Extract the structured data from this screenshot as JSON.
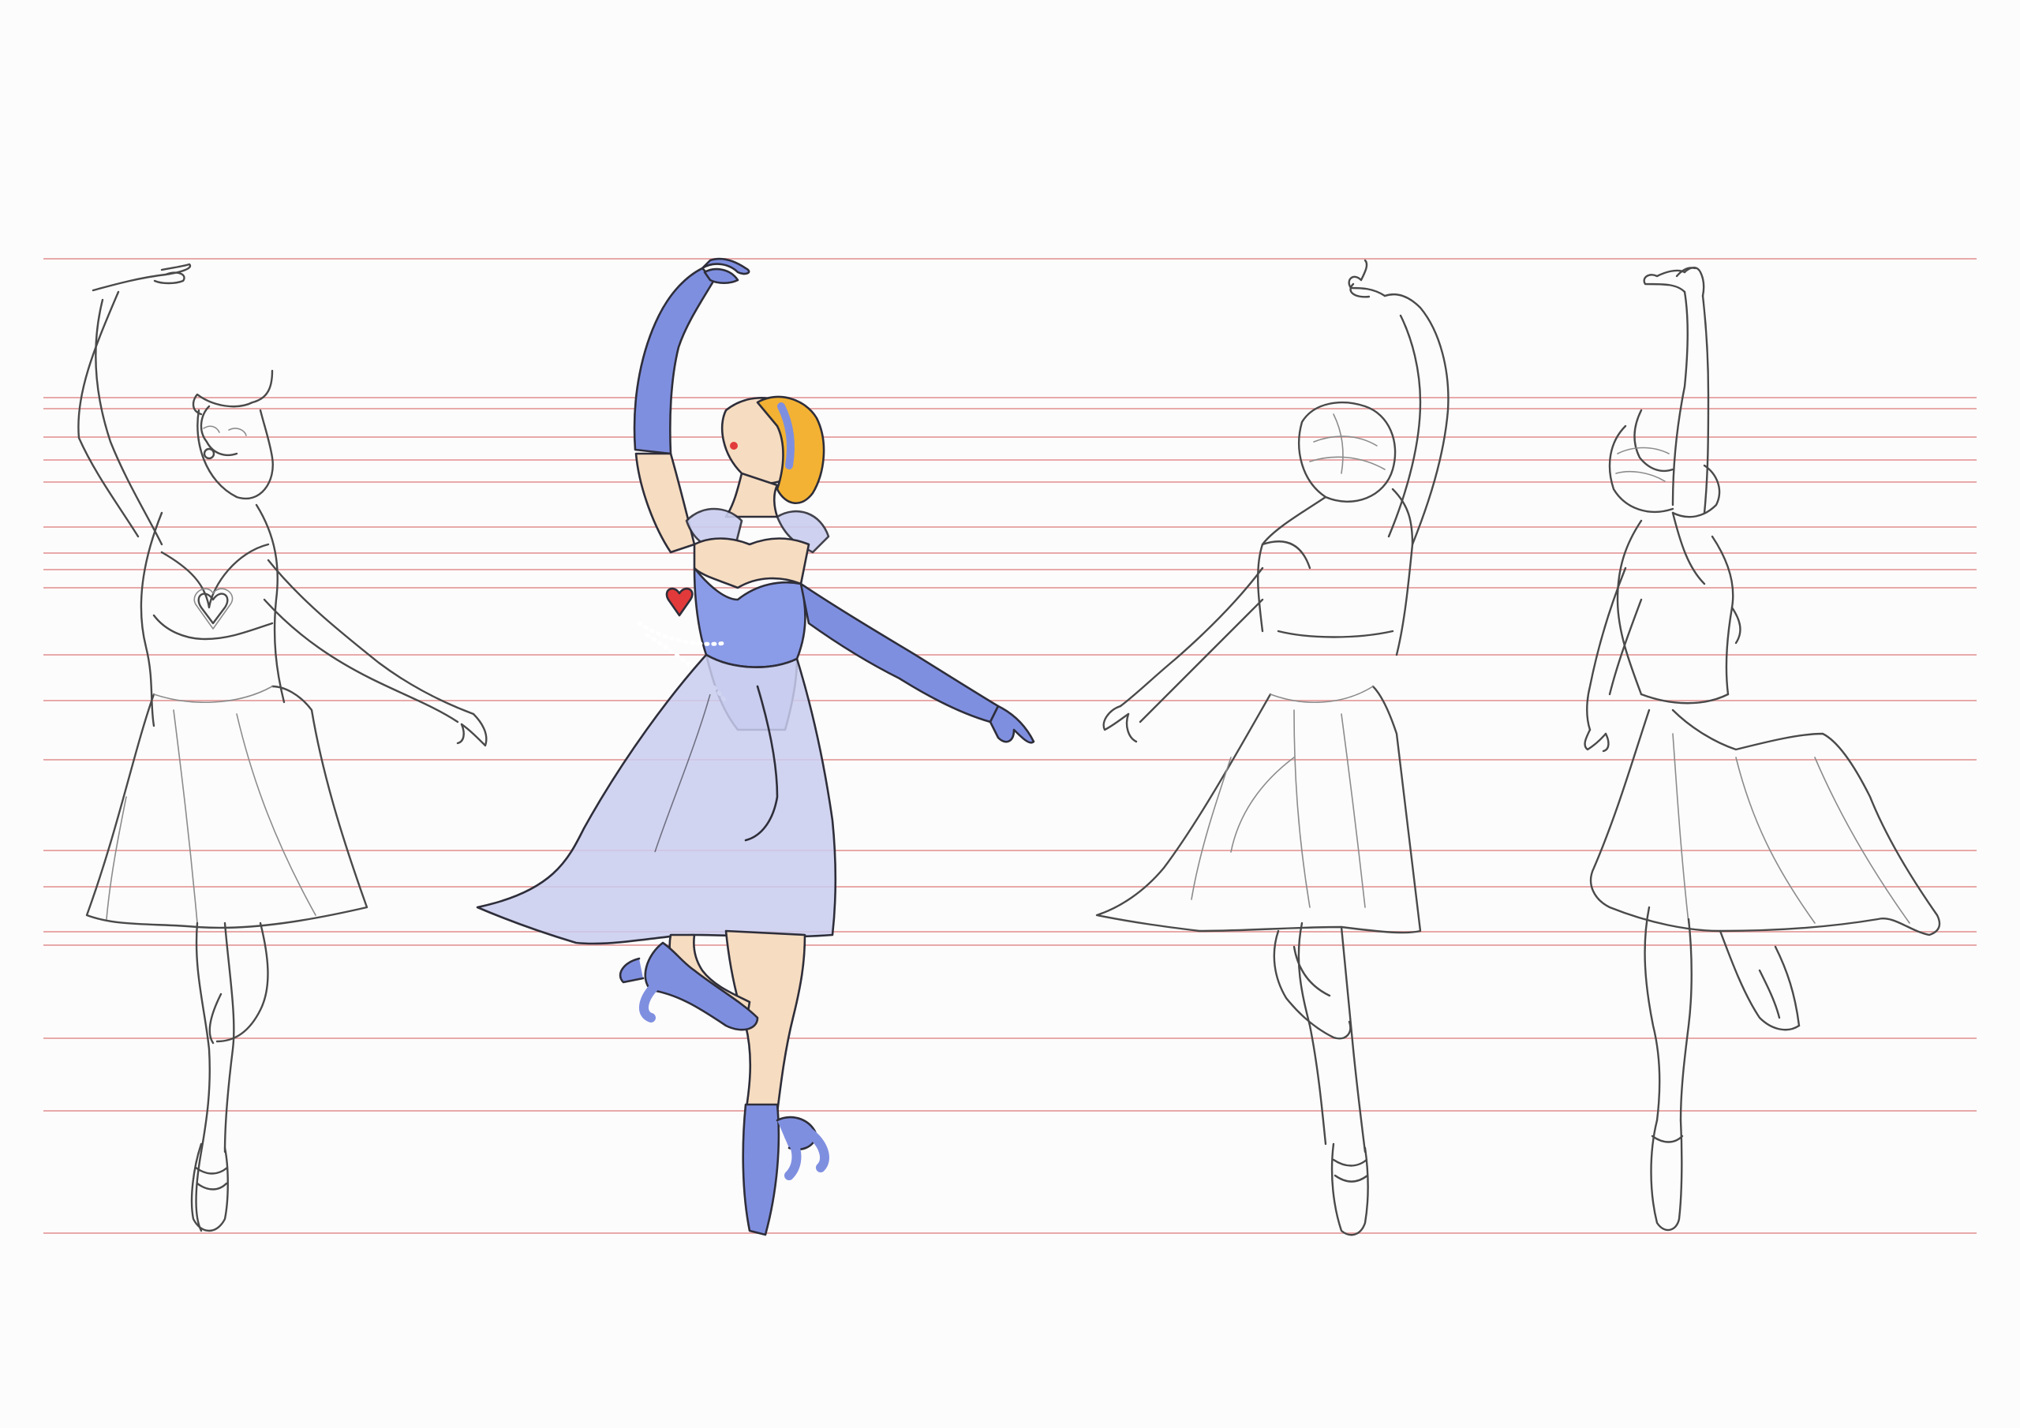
{
  "sheet": {
    "background": "#fdfcfc",
    "guide_color": "#e8a9a9",
    "sketch_color": "#4a4a4a",
    "palette": {
      "glove_and_shoe_blue": "#7f8fe0",
      "bodice_blue": "#8a9be8",
      "skirt_lavender": "#c9cdee",
      "hair_gold": "#f3b233",
      "skin": "#f6dcc0",
      "heart_red": "#e23a3a"
    }
  },
  "figures": [
    {
      "name": "front-view-sketch"
    },
    {
      "name": "three-quarter-view-colored"
    },
    {
      "name": "back-view-sketch"
    },
    {
      "name": "back-three-quarter-view-sketch"
    }
  ]
}
